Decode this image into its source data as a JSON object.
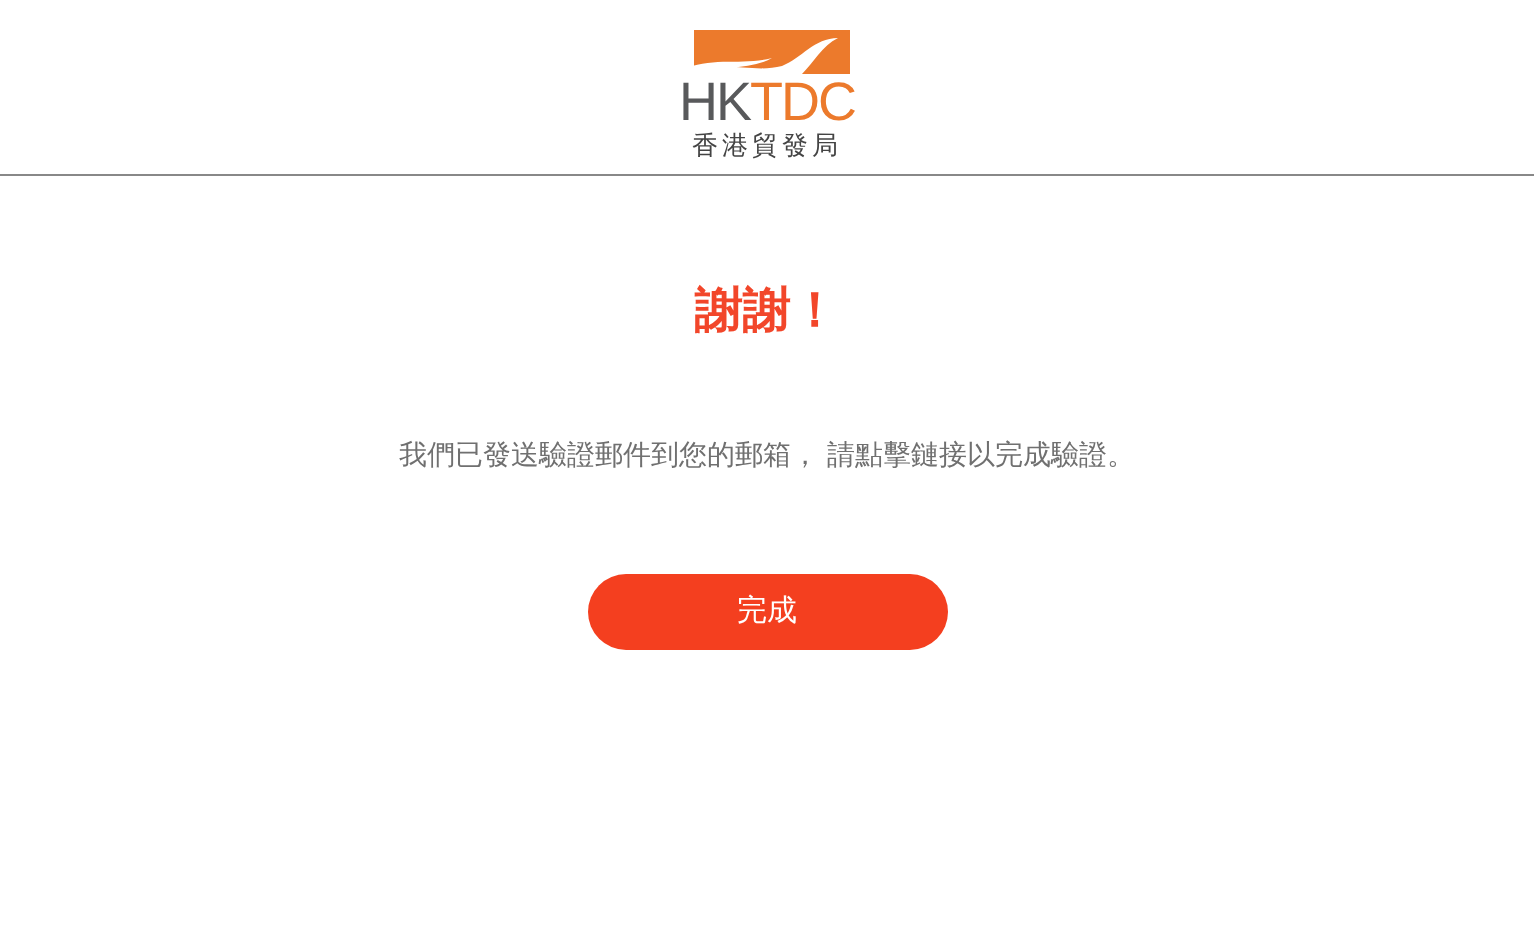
{
  "header": {
    "logo": {
      "wordmark_dark": "HK",
      "wordmark_orange": "TDC",
      "chinese_name": "香港貿發局"
    }
  },
  "title": "謝謝！",
  "message": "我們已發送驗證郵件到您的郵箱， 請點擊鏈接以完成驗證。",
  "button": {
    "label": "完成"
  }
}
